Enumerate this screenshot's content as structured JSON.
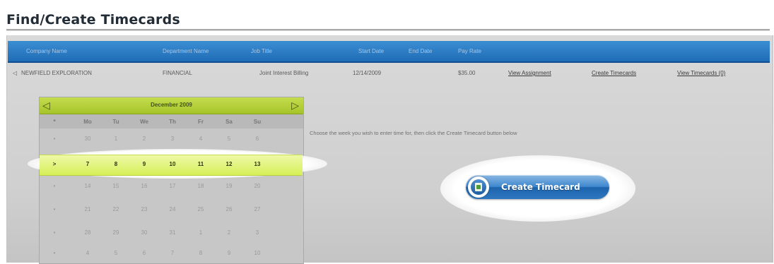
{
  "page": {
    "title": "Find/Create Timecards"
  },
  "table": {
    "headers": [
      "Company Name",
      "Department Name",
      "Job Title",
      "Start Date",
      "End Date",
      "Pay Rate"
    ],
    "row": {
      "marker": "◁",
      "company": "NEWFIELD EXPLORATION",
      "department": "FINANCIAL",
      "job_title": "Joint Interest Billing",
      "start_date": "12/14/2009",
      "end_date": "",
      "pay_rate": "$35.00",
      "links": [
        "View Assignment",
        "Create Timecards",
        "View Timecards (0)"
      ]
    }
  },
  "calendar": {
    "month_label": "December 2009",
    "prev_icon": "triangle-left-icon",
    "next_icon": "triangle-right-icon",
    "week_col_header": "*",
    "day_headers": [
      "Mo",
      "Tu",
      "We",
      "Th",
      "Fr",
      "Sa",
      "Su"
    ],
    "weeks": [
      {
        "marker": "•",
        "days": [
          "30",
          "1",
          "2",
          "3",
          "4",
          "5",
          "6"
        ]
      },
      {
        "marker": ">",
        "days": [
          "7",
          "8",
          "9",
          "10",
          "11",
          "12",
          "13"
        ],
        "selected": true
      },
      {
        "marker": "•",
        "days": [
          "14",
          "15",
          "16",
          "17",
          "18",
          "19",
          "20"
        ]
      },
      {
        "marker": "•",
        "days": [
          "21",
          "22",
          "23",
          "24",
          "25",
          "26",
          "27"
        ]
      },
      {
        "marker": "•",
        "days": [
          "28",
          "29",
          "30",
          "31",
          "1",
          "2",
          "3"
        ]
      },
      {
        "marker": "•",
        "days": [
          "4",
          "5",
          "6",
          "7",
          "8",
          "9",
          "10"
        ]
      }
    ]
  },
  "instructions": "Choose the week you wish to enter time for, then click the Create Timecard button below",
  "create_button": {
    "label": "Create Timecard",
    "icon": "timecard-icon"
  },
  "colors": {
    "header_bar": "#2d7dc6",
    "calendar_header": "#b5d03a",
    "week_highlight": "#e4f68a",
    "button": "#3f88cf"
  }
}
